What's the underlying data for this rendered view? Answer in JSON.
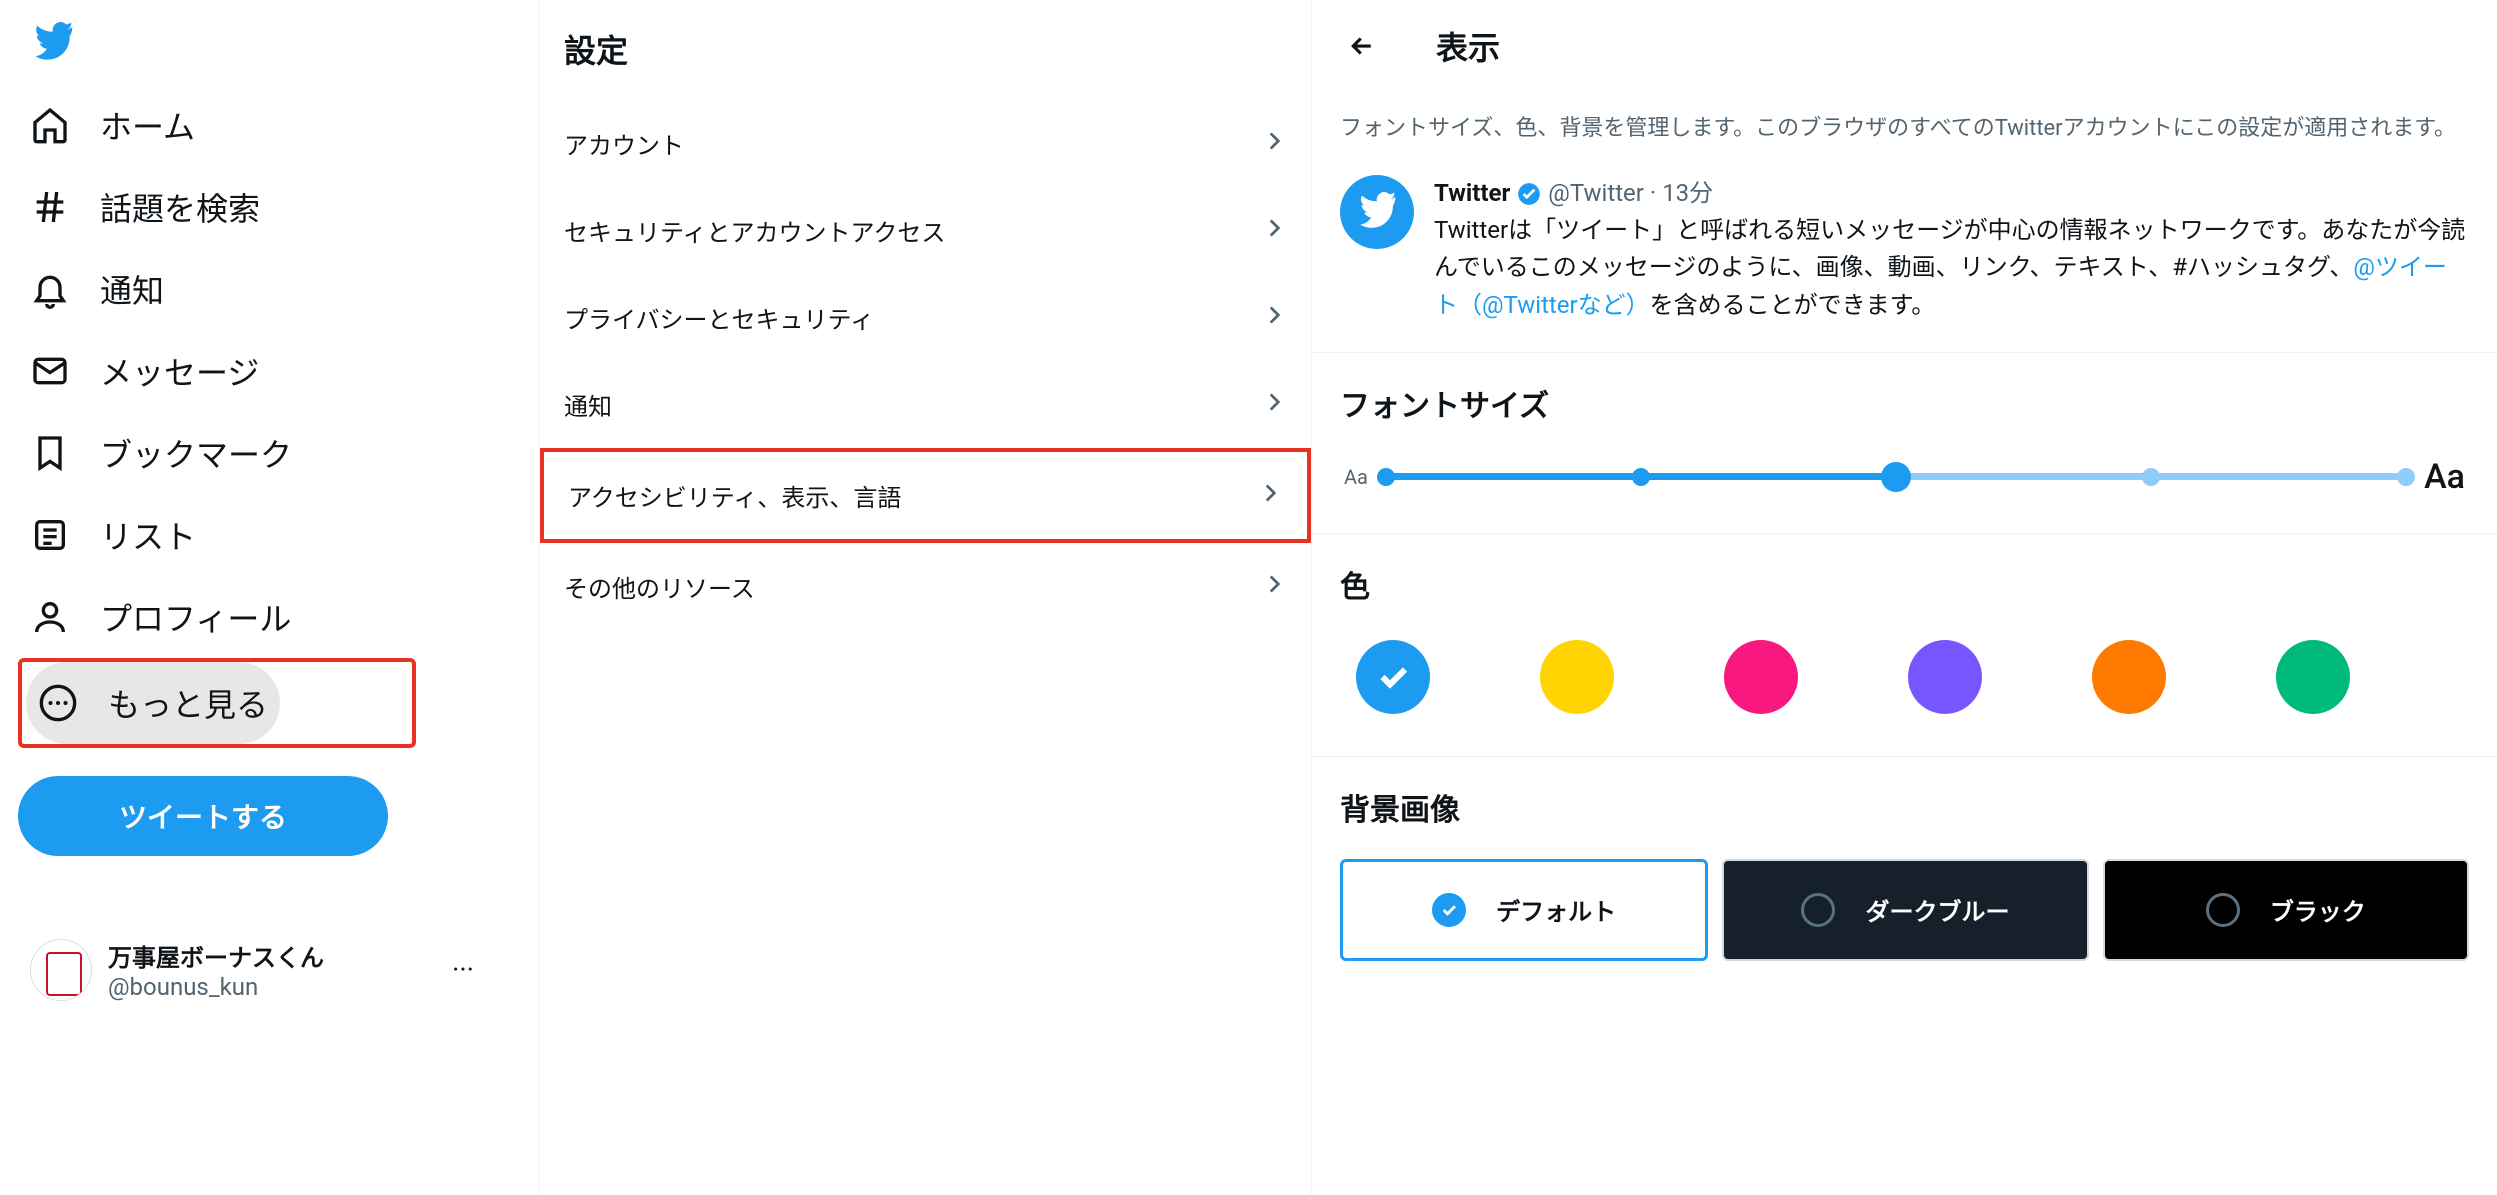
{
  "sidebar": {
    "items": [
      {
        "label": "ホーム",
        "icon": "home"
      },
      {
        "label": "話題を検索",
        "icon": "hash"
      },
      {
        "label": "通知",
        "icon": "bell"
      },
      {
        "label": "メッセージ",
        "icon": "mail"
      },
      {
        "label": "ブックマーク",
        "icon": "bookmark"
      },
      {
        "label": "リスト",
        "icon": "list"
      },
      {
        "label": "プロフィール",
        "icon": "user"
      },
      {
        "label": "もっと見る",
        "icon": "more"
      }
    ],
    "tweet_button": "ツイートする",
    "account": {
      "name": "万事屋ボーナスくん",
      "handle": "@bounus_kun"
    }
  },
  "settings": {
    "title": "設定",
    "items": [
      "アカウント",
      "セキュリティとアカウントアクセス",
      "プライバシーとセキュリティ",
      "通知",
      "アクセシビリティ、表示、言語",
      "その他のリソース"
    ],
    "highlighted_index": 4
  },
  "display": {
    "title": "表示",
    "description": "フォントサイズ、色、背景を管理します。このブラウザのすべてのTwitterアカウントにこの設定が適用されます。",
    "sample_tweet": {
      "name": "Twitter",
      "handle": "@Twitter",
      "time": "13分",
      "text_before": "Twitterは「ツイート」と呼ばれる短いメッセージが中心の情報ネットワークです。あなたが今読んでいるこのメッセージのように、画像、動画、リンク、テキスト、#ハッシュタグ、",
      "link": "@ツイート（@Twitterなど）",
      "text_after": "を含めることができます。"
    },
    "font_size": {
      "heading": "フォントサイズ",
      "small_label": "Aa",
      "large_label": "Aa",
      "steps": 5,
      "current": 2
    },
    "color": {
      "heading": "色",
      "options": [
        {
          "name": "blue",
          "hex": "#1d9bf0",
          "selected": true
        },
        {
          "name": "yellow",
          "hex": "#ffd400",
          "selected": false
        },
        {
          "name": "pink",
          "hex": "#f91880",
          "selected": false
        },
        {
          "name": "purple",
          "hex": "#7856ff",
          "selected": false
        },
        {
          "name": "orange",
          "hex": "#ff7a00",
          "selected": false
        },
        {
          "name": "green",
          "hex": "#00ba7c",
          "selected": false
        }
      ]
    },
    "background": {
      "heading": "背景画像",
      "options": [
        {
          "label": "デフォルト",
          "theme": "default",
          "selected": true
        },
        {
          "label": "ダークブルー",
          "theme": "dim",
          "selected": false
        },
        {
          "label": "ブラック",
          "theme": "black",
          "selected": false
        }
      ]
    }
  }
}
